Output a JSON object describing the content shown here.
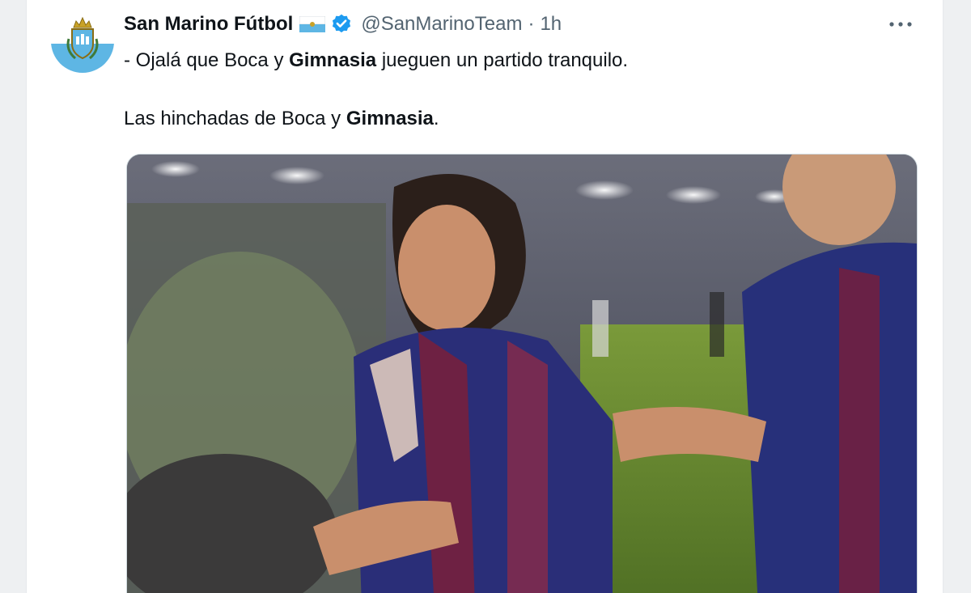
{
  "tweet": {
    "display_name": "San Marino Fútbol",
    "handle": "@SanMarinoTeam",
    "separator": "·",
    "time": "1h",
    "more_label": "•••",
    "line1": {
      "pre": "- Ojalá que Boca y ",
      "bold": "Gimnasia",
      "post": " jueguen un partido tranquilo."
    },
    "line2": {
      "pre": "Las hinchadas de Boca y ",
      "bold": "Gimnasia",
      "post": "."
    }
  },
  "icons": {
    "avatar": "san-marino-crest-icon",
    "flag": "san-marino-flag-icon",
    "verified": "verified-badge-icon",
    "more": "more-options-icon"
  },
  "colors": {
    "verified_blue": "#1d9bf0",
    "flag_light_blue": "#5eb6e4",
    "text_primary": "#0f1419",
    "text_secondary": "#536471"
  }
}
